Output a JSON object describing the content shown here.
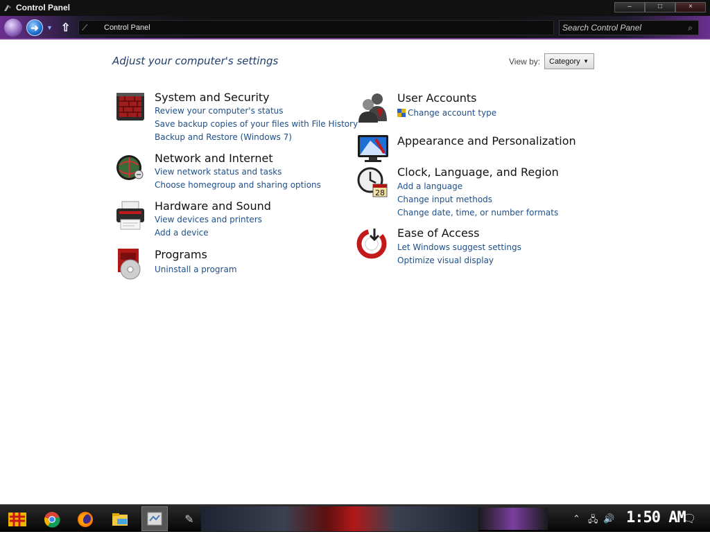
{
  "window": {
    "title": "Control Panel",
    "minimize_label": "–",
    "maximize_label": "□",
    "close_label": "×"
  },
  "addressbar": {
    "breadcrumb": "Control Panel",
    "search_placeholder": "Search Control Panel"
  },
  "main": {
    "heading": "Adjust your computer's settings",
    "view_by_label": "View by:",
    "view_by_value": "Category"
  },
  "categories": [
    {
      "title": "System and Security",
      "icon": "firewall-icon",
      "links": [
        "Review your computer's status",
        "Save backup copies of your files with File History",
        "Backup and Restore (Windows 7)"
      ]
    },
    {
      "title": "Network and Internet",
      "icon": "globe-network-icon",
      "links": [
        "View network status and tasks",
        "Choose homegroup and sharing options"
      ]
    },
    {
      "title": "Hardware and Sound",
      "icon": "printer-icon",
      "links": [
        "View devices and printers",
        "Add a device"
      ]
    },
    {
      "title": "Programs",
      "icon": "programs-disc-icon",
      "links": [
        "Uninstall a program"
      ]
    },
    {
      "title": "User Accounts",
      "icon": "users-icon",
      "links": [
        "Change account type"
      ]
    },
    {
      "title": "Appearance and Personalization",
      "icon": "monitor-icon",
      "links": []
    },
    {
      "title": "Clock, Language, and Region",
      "icon": "clock-icon",
      "calendar_day": "28",
      "links": [
        "Add a language",
        "Change input methods",
        "Change date, time, or number formats"
      ]
    },
    {
      "title": "Ease of Access",
      "icon": "ease-of-access-icon",
      "links": [
        "Let Windows suggest settings",
        "Optimize visual display"
      ]
    }
  ],
  "taskbar": {
    "clock": "1:50 AM",
    "apps": [
      "chrome-icon",
      "firefox-icon",
      "file-explorer-icon",
      "control-panel-icon"
    ]
  },
  "colors": {
    "link": "#1e4f88",
    "heading": "#1e3d6a",
    "accent": "#7a3fa0"
  }
}
